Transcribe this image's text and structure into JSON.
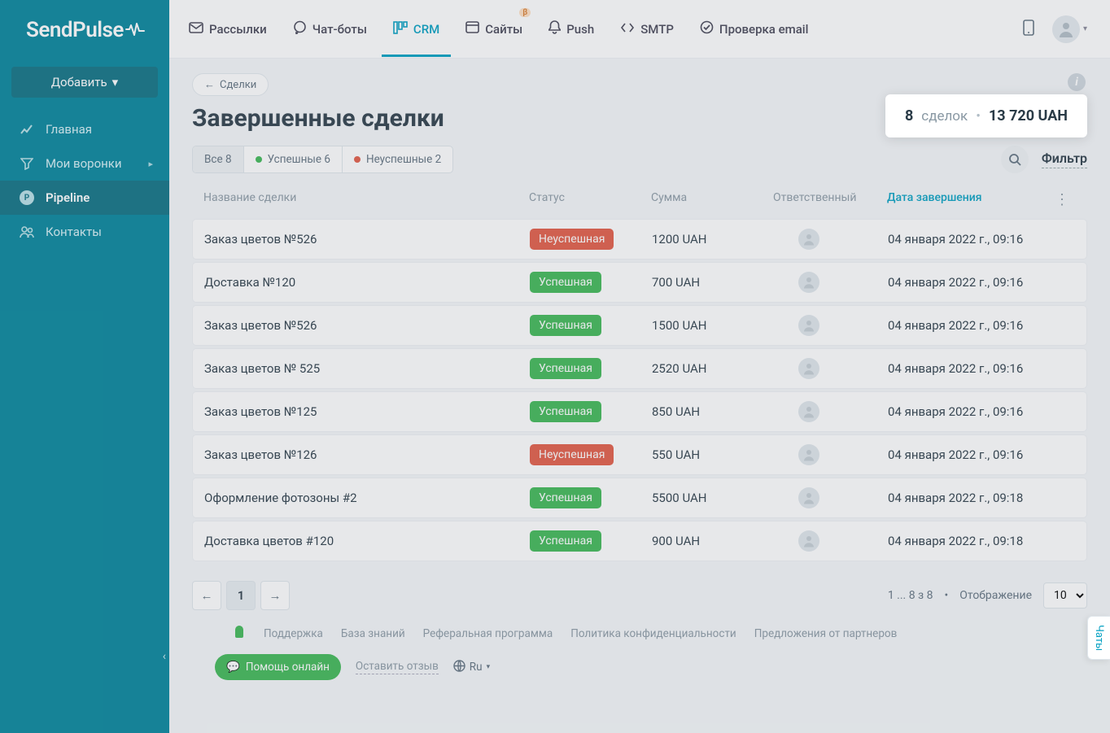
{
  "brand": "SendPulse",
  "sidebar": {
    "add_label": "Добавить",
    "items": [
      {
        "label": "Главная"
      },
      {
        "label": "Мои воронки"
      },
      {
        "label": "Pipeline"
      },
      {
        "label": "Контакты"
      }
    ]
  },
  "topnav": {
    "items": [
      {
        "label": "Рассылки"
      },
      {
        "label": "Чат-боты"
      },
      {
        "label": "CRM"
      },
      {
        "label": "Сайты"
      },
      {
        "label": "Push"
      },
      {
        "label": "SMTP"
      },
      {
        "label": "Проверка email"
      }
    ],
    "beta": "β"
  },
  "page": {
    "back_label": "Сделки",
    "title": "Завершенные сделки",
    "summary": {
      "count": "8",
      "word": "сделок",
      "amount": "13 720 UAH"
    },
    "filters": {
      "all": "Все 8",
      "success": "Успешные 6",
      "fail": "Неуспешные 2",
      "filter_link": "Фильтр"
    },
    "columns": {
      "name": "Название сделки",
      "status": "Статус",
      "amount": "Сумма",
      "owner": "Ответственный",
      "date": "Дата завершения"
    },
    "status_labels": {
      "success": "Успешная",
      "fail": "Неуспешная"
    },
    "rows": [
      {
        "name": "Заказ цветов №526",
        "status": "fail",
        "amount": "1200 UAH",
        "date": "04 января 2022 г., 09:16"
      },
      {
        "name": "Доставка №120",
        "status": "success",
        "amount": "700 UAH",
        "date": "04 января 2022 г., 09:16"
      },
      {
        "name": "Заказ цветов №526",
        "status": "success",
        "amount": "1500 UAH",
        "date": "04 января 2022 г., 09:16"
      },
      {
        "name": "Заказ цветов № 525",
        "status": "success",
        "amount": "2520 UAH",
        "date": "04 января 2022 г., 09:16"
      },
      {
        "name": "Заказ цветов №125",
        "status": "success",
        "amount": "850 UAH",
        "date": "04 января 2022 г., 09:16"
      },
      {
        "name": "Заказ цветов №126",
        "status": "fail",
        "amount": "550 UAH",
        "date": "04 января 2022 г., 09:16"
      },
      {
        "name": "Оформление фотозоны #2",
        "status": "success",
        "amount": "5500 UAH",
        "date": "04 января 2022 г., 09:18"
      },
      {
        "name": "Доставка цветов #120",
        "status": "success",
        "amount": "900 UAH",
        "date": "04 января 2022 г., 09:18"
      }
    ],
    "pagination": {
      "prev": "←",
      "page": "1",
      "next": "→",
      "info": "1 ... 8 з 8",
      "display_label": "Отображение",
      "per_page": "10"
    }
  },
  "footer": {
    "links": [
      "Поддержка",
      "База знаний",
      "Реферальная программа",
      "Политика конфиденциальности",
      "Предложения от партнеров"
    ],
    "help": "Помощь онлайн",
    "feedback": "Оставить отзыв",
    "lang": "Ru"
  },
  "chat_tab": "Чаты"
}
